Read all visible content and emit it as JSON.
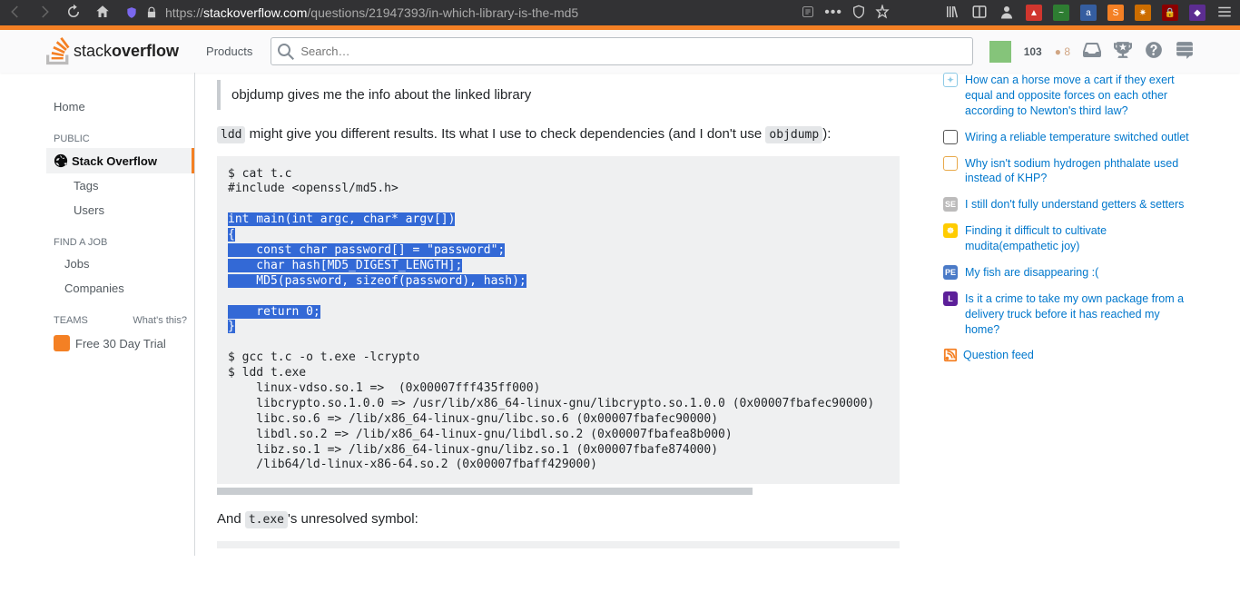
{
  "browser": {
    "url_pre": "https://",
    "url_domain": "stackoverflow.com",
    "url_post": "/questions/21947393/in-which-library-is-the-md5"
  },
  "topbar": {
    "products": "Products",
    "search_placeholder": "Search…",
    "rep": "103",
    "bronze_dot": "●",
    "bronze": "8"
  },
  "logo": {
    "stack": "stack",
    "overflow": "overflow"
  },
  "sidebar": {
    "home": "Home",
    "public": "PUBLIC",
    "stackoverflow": "Stack Overflow",
    "tags": "Tags",
    "users": "Users",
    "findjob": "FIND A JOB",
    "jobs": "Jobs",
    "companies": "Companies",
    "teams": "TEAMS",
    "whats_this": "What's this?",
    "free_trial": "Free 30 Day Trial"
  },
  "answer": {
    "blockquote": "objdump gives me the info about the linked library",
    "p1_a": "ldd",
    "p1_b": " might give you different results. Its what I use to check dependencies (and I don't use ",
    "p1_c": "objdump",
    "p1_d": "):",
    "code": {
      "l1": "$ cat t.c",
      "l2": "#include <openssl/md5.h>",
      "s1": "int main(int argc, char* argv[])",
      "s2": "{",
      "s3": "    const char password[] = \"password\";",
      "s4": "    char hash[MD5_DIGEST_LENGTH];",
      "s5": "    MD5(password, sizeof(password), hash);",
      "s6": "    return 0;",
      "s7": "}",
      "l3": "$ gcc t.c -o t.exe -lcrypto",
      "l4": "$ ldd t.exe",
      "l5": "    linux-vdso.so.1 =>  (0x00007fff435ff000)",
      "l6": "    libcrypto.so.1.0.0 => /usr/lib/x86_64-linux-gnu/libcrypto.so.1.0.0 (0x00007fbafec90000)",
      "l7": "    libc.so.6 => /lib/x86_64-linux-gnu/libc.so.6 (0x00007fbafec90000)",
      "l8": "    libdl.so.2 => /lib/x86_64-linux-gnu/libdl.so.2 (0x00007fbafea8b000)",
      "l9": "    libz.so.1 => /lib/x86_64-linux-gnu/libz.so.1 (0x00007fbafe874000)",
      "l10": "    /lib64/ld-linux-x86-64.so.2 (0x00007fbaff429000)"
    },
    "p2_a": "And ",
    "p2_b": "t.exe",
    "p2_c": "'s unresolved symbol:"
  },
  "rightbar": {
    "links": [
      "How can a horse move a cart if they exert equal and opposite forces on each other according to Newton's third law?",
      "Wiring a reliable temperature switched outlet",
      "Why isn't sodium hydrogen phthalate used instead of KHP?",
      "I still don't fully understand getters & setters",
      "Finding it difficult to cultivate mudita(empathetic joy)",
      "My fish are disappearing :(",
      "Is it a crime to take my own package from a delivery truck before it has reached my home?"
    ],
    "qfeed": "Question feed"
  }
}
